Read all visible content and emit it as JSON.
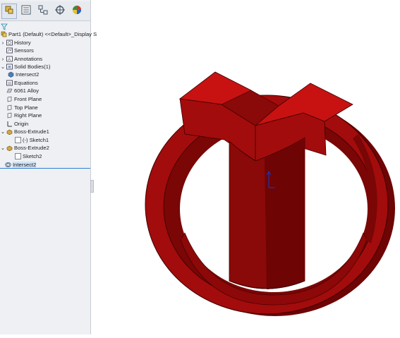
{
  "tabs": [
    {
      "name": "feature-manager-tab-icon",
      "active": true
    },
    {
      "name": "property-manager-tab-icon",
      "active": false
    },
    {
      "name": "configuration-manager-tab-icon",
      "active": false
    },
    {
      "name": "dimxpert-manager-tab-icon",
      "active": false
    },
    {
      "name": "display-manager-tab-icon",
      "active": false
    }
  ],
  "tree": {
    "root": "Part1 (Default) <<Default>_Display S",
    "items": [
      {
        "label": "History",
        "icon": "history-icon"
      },
      {
        "label": "Sensors",
        "icon": "sensors-icon"
      },
      {
        "label": "Annotations",
        "icon": "annotations-icon"
      },
      {
        "label": "Solid Bodies(1)",
        "icon": "solid-bodies-folder-icon"
      },
      {
        "label": "Intersect2",
        "icon": "solid-body-icon"
      },
      {
        "label": "Equations",
        "icon": "equations-icon"
      },
      {
        "label": "6061 Alloy",
        "icon": "material-icon"
      },
      {
        "label": "Front Plane",
        "icon": "plane-icon"
      },
      {
        "label": "Top Plane",
        "icon": "plane-icon"
      },
      {
        "label": "Right Plane",
        "icon": "plane-icon"
      },
      {
        "label": "Origin",
        "icon": "origin-icon"
      },
      {
        "label": "Boss-Extrude1",
        "icon": "extrude-icon"
      },
      {
        "label": "(-) Sketch1",
        "icon": "sketch-icon"
      },
      {
        "label": "Boss-Extrude2",
        "icon": "extrude-icon"
      },
      {
        "label": "Sketch2",
        "icon": "sketch-icon"
      },
      {
        "label": "Intersect2",
        "icon": "intersect-icon"
      }
    ]
  },
  "colors": {
    "model_face_front": "#a30c0c",
    "model_face_top": "#c81212",
    "model_face_side": "#6e0404",
    "model_edge": "#3a0000",
    "selection": "#2a7fd4"
  }
}
